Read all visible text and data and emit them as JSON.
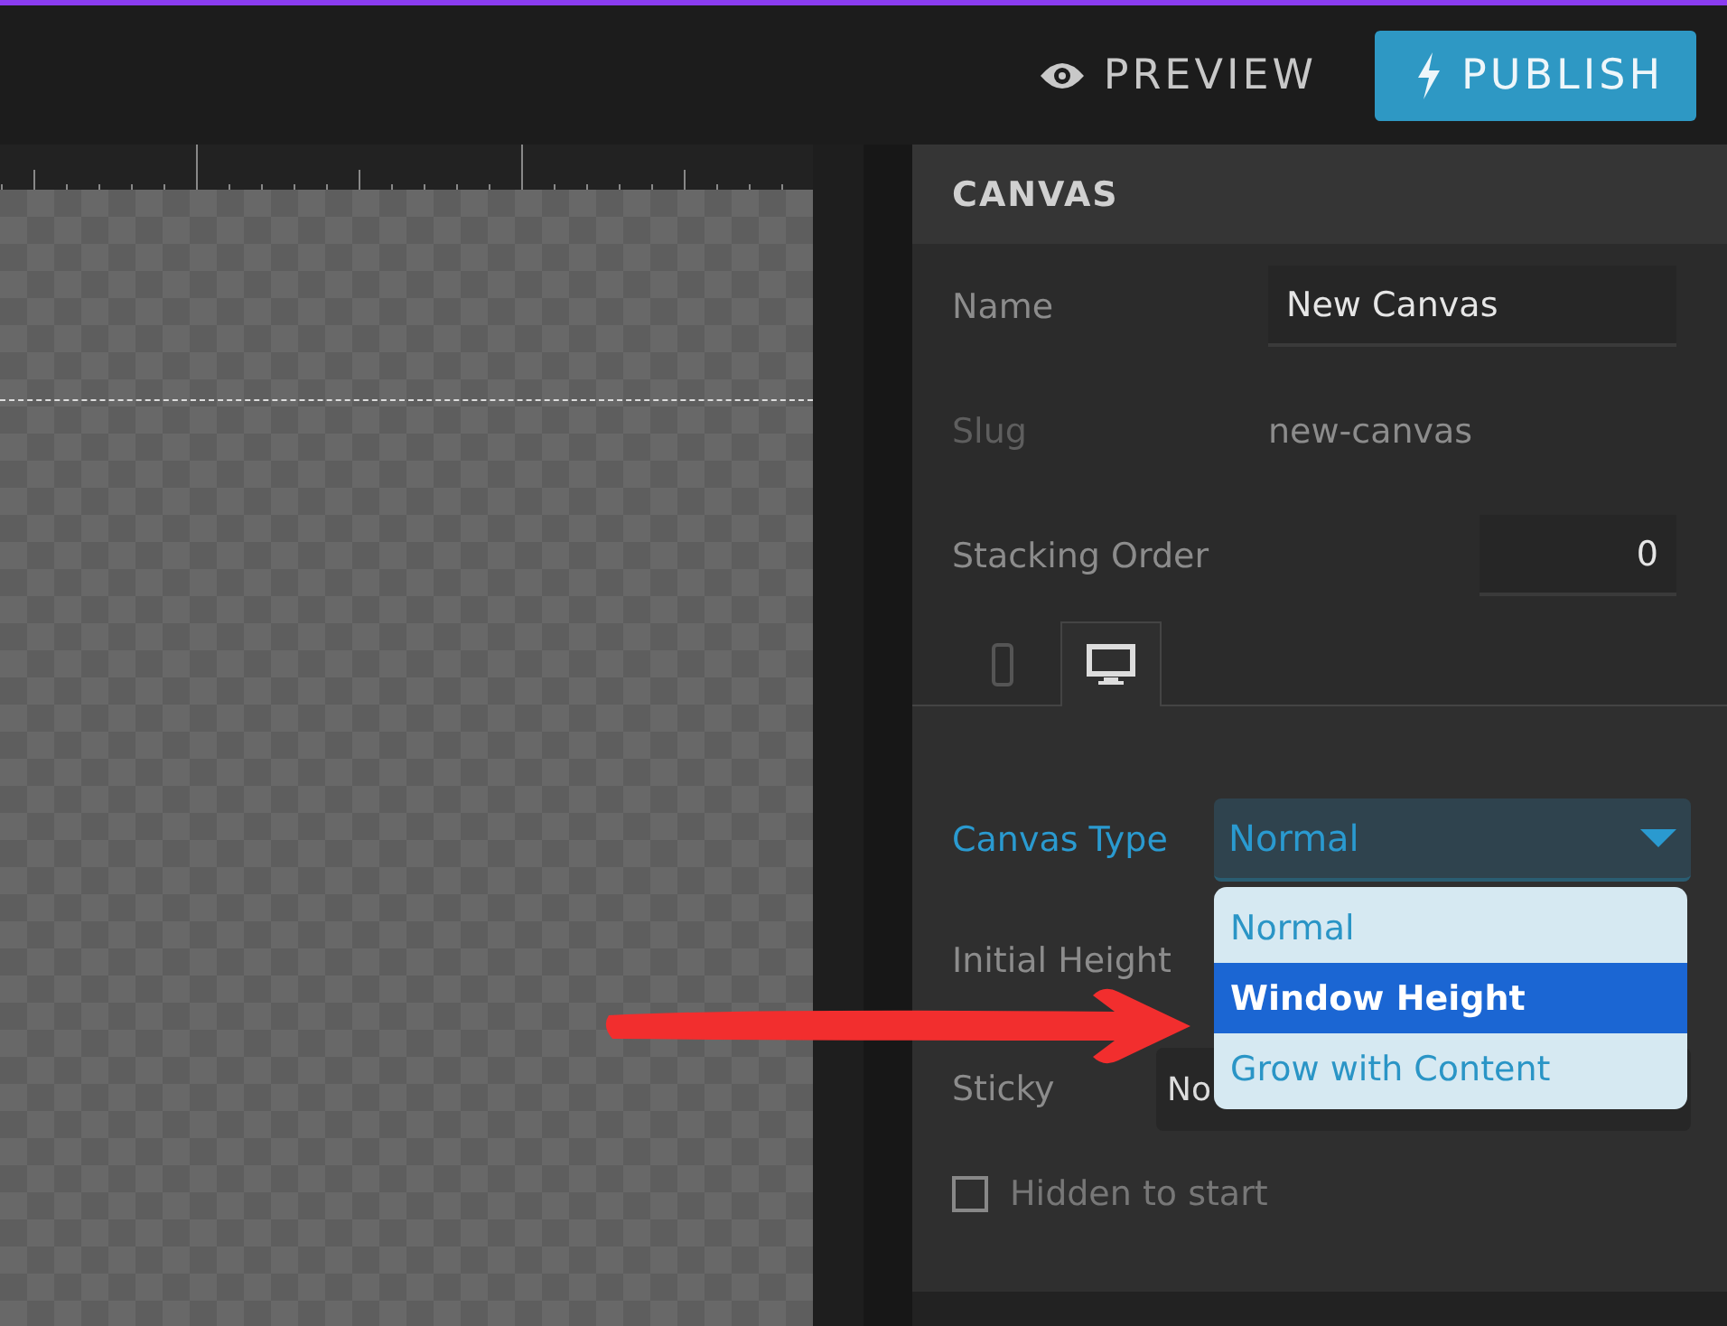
{
  "toolbar": {
    "preview_label": "PREVIEW",
    "publish_label": "PUBLISH"
  },
  "panel": {
    "title": "CANVAS",
    "fields": [
      {
        "kind": "input",
        "label": "Name",
        "value": "New Canvas"
      },
      {
        "kind": "text",
        "label": "Slug",
        "value": "new-canvas"
      },
      {
        "kind": "number",
        "label": "Stacking Order",
        "value": "0"
      }
    ],
    "device_tabs": [
      {
        "kind": "phone",
        "selected": false
      },
      {
        "kind": "desktop",
        "selected": true
      }
    ],
    "canvas_type": {
      "label": "Canvas Type",
      "value": "Normal",
      "expanded": true,
      "options": [
        {
          "label": "Normal",
          "highlighted": false
        },
        {
          "label": "Window Height",
          "highlighted": true
        },
        {
          "label": "Grow with Content",
          "highlighted": false
        }
      ]
    },
    "initial_height": {
      "label": "Initial Height"
    },
    "sticky": {
      "label": "Sticky",
      "value": "No"
    },
    "hidden": {
      "label": "Hidden to start",
      "checked": false
    }
  },
  "annotation": {
    "kind": "arrow"
  }
}
